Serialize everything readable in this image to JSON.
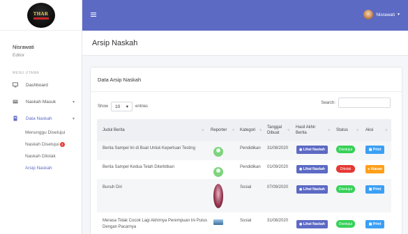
{
  "logo": {
    "text": "THAR"
  },
  "sidebar": {
    "user_name": "Nisrawati",
    "user_role": "Editor",
    "section_label": "MENU UTAMA",
    "items": [
      {
        "label": "Dashboard",
        "icon": "monitor-icon"
      },
      {
        "label": "Naskah Masuk",
        "icon": "inbox-icon"
      },
      {
        "label": "Data Naskah",
        "icon": "document-icon"
      }
    ],
    "subitems": [
      {
        "label": "Menunggu Disetujui"
      },
      {
        "label": "Naskah Disetujui",
        "badge": "3"
      },
      {
        "label": "Naskah Ditolak"
      },
      {
        "label": "Arsip Naskah"
      }
    ]
  },
  "topbar": {
    "user_name": "Nisrawati",
    "accent": "#5c6ac4"
  },
  "page": {
    "title": "Arsip Naskah"
  },
  "card": {
    "title": "Data Arsip Naskah",
    "show_label": "Show",
    "entries_value": "10",
    "entries_label": "entries",
    "search_label": "Search:"
  },
  "table": {
    "headers": [
      "Judul Berita",
      "Reporter",
      "Kategori",
      "Tanggal Dibuat",
      "Hasil Akhir Berita",
      "Status",
      "Aksi"
    ],
    "rows": [
      {
        "judul": "Berita Sampel Ini di Buat Untuk Keperluan Testing",
        "reporter_icon": "avatar-icon",
        "kategori": "Pendidikan",
        "tanggal": "31/08/2020",
        "hasil": "Lihat Naskah",
        "status": "Disetujui",
        "aksi": "Print"
      },
      {
        "judul": "Berita Sampel Kedua Telah Diterbitkan",
        "reporter_icon": "avatar-icon",
        "kategori": "Pendidikan",
        "tanggal": "01/09/2020",
        "hasil": "Lihat Naskah",
        "status": "Ditolak",
        "aksi": "Alasan"
      },
      {
        "judul": "Bunuh Diri",
        "reporter_icon": "photo-icon",
        "kategori": "Sosial",
        "tanggal": "07/09/2020",
        "hasil": "Lihat Naskah",
        "status": "Disetujui",
        "aksi": "Print"
      },
      {
        "judul": "Merasa Tidak Cocok Lagi Akhirnya Perempuan Ini Putus Dengan Pacarnya",
        "reporter_icon": "photo-icon",
        "kategori": "Sosial",
        "tanggal": "31/08/2020",
        "hasil": "Lihat Naskah",
        "status": "Disetujui",
        "aksi": "Print"
      }
    ]
  }
}
